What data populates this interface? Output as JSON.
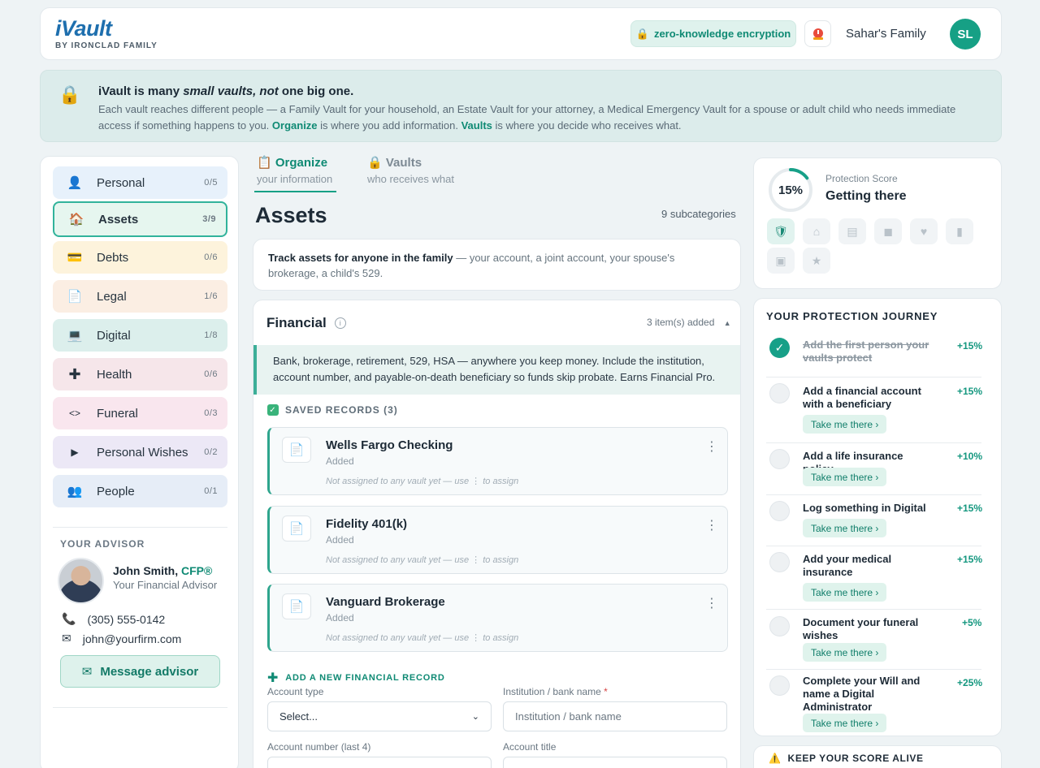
{
  "header": {
    "logo": "iVault",
    "logo_sub": "BY IRONCLAD FAMILY",
    "encryption_badge": "zero-knowledge encryption",
    "family_name": "Sahar's Family",
    "avatar_initials": "SL"
  },
  "banner": {
    "title_start": "iVault is many ",
    "title_italic": "small vaults, not",
    "title_end": " one big one.",
    "body_1": "Each vault reaches different people — a Family Vault for your household, an Estate Vault for your attorney, a Medical Emergency Vault for a spouse or adult child who needs immediate access if something happens to you. ",
    "organize": "Organize",
    "body_2": " is where you add information. ",
    "vaults": "Vaults",
    "body_3": " is where you decide who receives what."
  },
  "sidebar": {
    "items": [
      {
        "label": "Personal",
        "count": "0/5",
        "icon": "person-icon"
      },
      {
        "label": "Assets",
        "count": "3/9",
        "icon": "house-icon"
      },
      {
        "label": "Debts",
        "count": "0/6",
        "icon": "card-icon"
      },
      {
        "label": "Legal",
        "count": "1/6",
        "icon": "document-icon"
      },
      {
        "label": "Digital",
        "count": "1/8",
        "icon": "laptop-icon"
      },
      {
        "label": "Health",
        "count": "0/6",
        "icon": "plus-icon"
      },
      {
        "label": "Funeral",
        "count": "0/3",
        "icon": "funeral-icon"
      },
      {
        "label": "Personal Wishes",
        "count": "0/2",
        "icon": "play-icon"
      },
      {
        "label": "People",
        "count": "0/1",
        "icon": "people-icon"
      }
    ],
    "advisor": {
      "heading": "YOUR ADVISOR",
      "name": "John Smith,",
      "credential": "CFP®",
      "role": "Your Financial Advisor",
      "phone": "(305) 555-0142",
      "email": "john@yourfirm.com",
      "message_button": "Message advisor"
    }
  },
  "tabs": [
    {
      "label": "Organize",
      "sub": "your information"
    },
    {
      "label": "Vaults",
      "sub": "who receives what"
    }
  ],
  "main": {
    "title": "Assets",
    "subcategories": "9 subcategories",
    "intro_bold": "Track assets for anyone in the family",
    "intro_rest": " — your account, a joint account, your spouse's brokerage, a child's 529.",
    "section": {
      "title": "Financial",
      "items_added": "3 item(s) added",
      "description": "Bank, brokerage, retirement, 529, HSA — anywhere you keep money. Include the institution, account number, and payable-on-death beneficiary so funds skip probate. Earns Financial Pro.",
      "saved_heading": "SAVED RECORDS (3)",
      "records": [
        {
          "name": "Wells Fargo Checking",
          "status": "Added",
          "note": "Not assigned to any vault yet — use  ⋮  to assign"
        },
        {
          "name": "Fidelity 401(k)",
          "status": "Added",
          "note": "Not assigned to any vault yet — use  ⋮  to assign"
        },
        {
          "name": "Vanguard Brokerage",
          "status": "Added",
          "note": "Not assigned to any vault yet — use  ⋮  to assign"
        }
      ],
      "add_new": "ADD A NEW FINANCIAL RECORD",
      "form": {
        "account_type_label": "Account type",
        "account_type_value": "Select...",
        "institution_label": "Institution / bank name",
        "institution_placeholder": "Institution / bank name",
        "account_number_label": "Account number (last 4)",
        "account_title_label": "Account title"
      }
    }
  },
  "score": {
    "percent_text": "15%",
    "percent_value": 15,
    "label": "Protection Score",
    "status": "Getting there",
    "badges": [
      "shield-icon",
      "house-icon",
      "document-icon",
      "chat-icon",
      "heart-icon",
      "candle-icon",
      "laptop-icon",
      "star-icon"
    ]
  },
  "journey": {
    "heading": "YOUR PROTECTION JOURNEY",
    "take_me": "Take me there ›",
    "steps": [
      {
        "text": "Add the first person your vaults protect",
        "pct": "+15%",
        "done": true
      },
      {
        "text": "Add a financial account with a beneficiary",
        "pct": "+15%",
        "done": false
      },
      {
        "text": "Add a life insurance policy",
        "pct": "+10%",
        "done": false
      },
      {
        "text": "Log something in Digital",
        "pct": "+15%",
        "done": false
      },
      {
        "text": "Add your medical insurance",
        "pct": "+15%",
        "done": false
      },
      {
        "text": "Document your funeral wishes",
        "pct": "+5%",
        "done": false
      },
      {
        "text": "Complete your Will and name a Digital Administrator",
        "pct": "+25%",
        "done": false
      }
    ]
  },
  "keep_alive": "KEEP YOUR SCORE ALIVE",
  "colors": {
    "accent": "#16a085",
    "brand": "#1e6fae"
  }
}
